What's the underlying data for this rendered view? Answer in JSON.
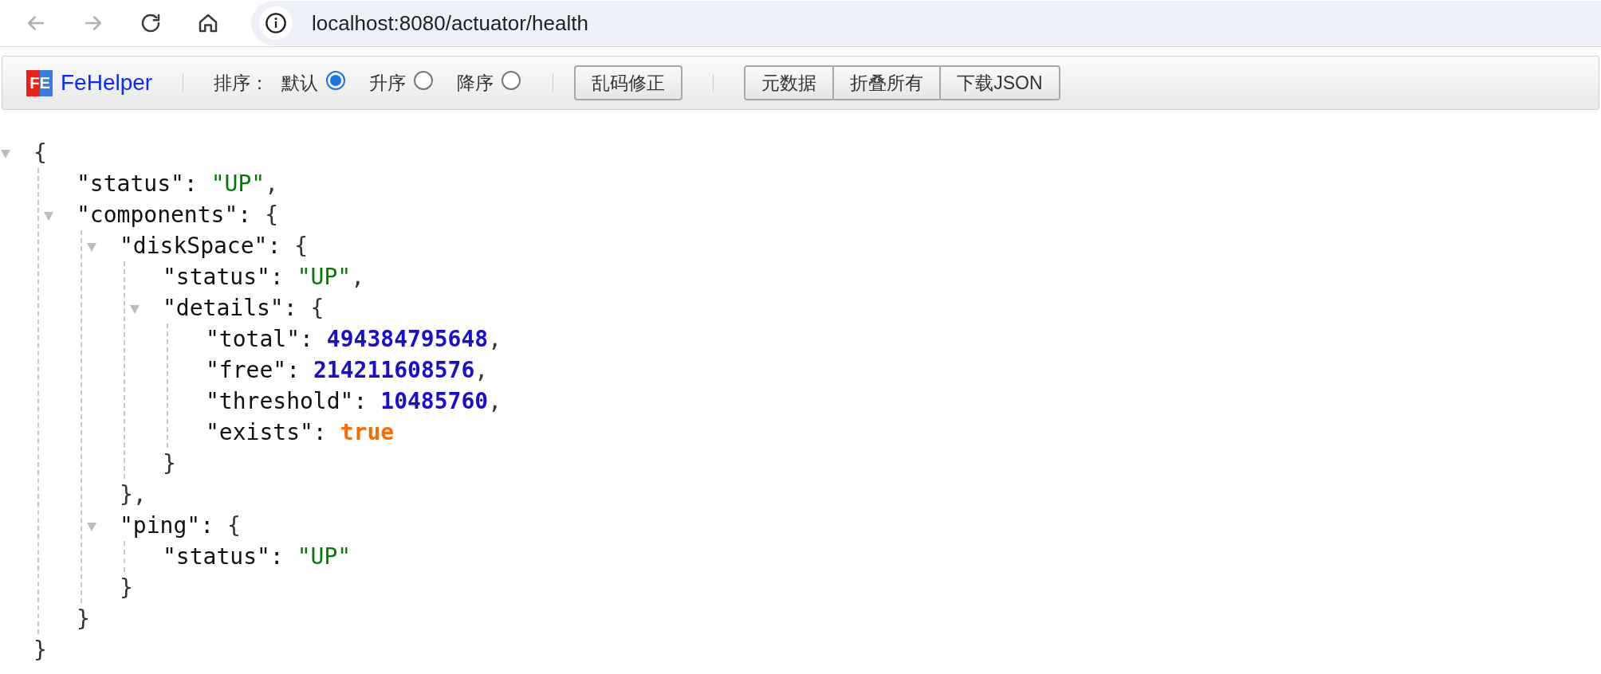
{
  "browser": {
    "nav": [
      {
        "kind": "back",
        "disabled": true
      },
      {
        "kind": "forward",
        "disabled": true
      },
      {
        "kind": "reload",
        "disabled": false
      },
      {
        "kind": "home",
        "disabled": false
      }
    ],
    "url": "localhost:8080/actuator/health"
  },
  "toolbar": {
    "logo_text": "FE",
    "brand": "FeHelper",
    "sort_label": "排序：",
    "sort_options": [
      {
        "label": "默认",
        "selected": true
      },
      {
        "label": "升序",
        "selected": false
      },
      {
        "label": "降序",
        "selected": false
      }
    ],
    "fix_button": "乱码修正",
    "button_group": [
      "元数据",
      "折叠所有",
      "下载JSON"
    ]
  },
  "json": {
    "open": "{",
    "close": "}",
    "expanded": true,
    "children": [
      {
        "kind": "string",
        "key": "\"status\":",
        "value": "\"UP\"",
        "comma": ","
      },
      {
        "kind": "object",
        "key": "\"components\":",
        "open": "{",
        "close": "}",
        "expanded": true,
        "children": [
          {
            "kind": "object",
            "key": "\"diskSpace\":",
            "open": "{",
            "close": "},",
            "expanded": true,
            "children": [
              {
                "kind": "string",
                "key": "\"status\":",
                "value": "\"UP\"",
                "comma": ","
              },
              {
                "kind": "object",
                "key": "\"details\":",
                "open": "{",
                "close": "}",
                "expanded": true,
                "children": [
                  {
                    "kind": "number",
                    "key": "\"total\":",
                    "value": "494384795648",
                    "comma": ","
                  },
                  {
                    "kind": "number",
                    "key": "\"free\":",
                    "value": "214211608576",
                    "comma": ","
                  },
                  {
                    "kind": "number",
                    "key": "\"threshold\":",
                    "value": "10485760",
                    "comma": ","
                  },
                  {
                    "kind": "boolean",
                    "key": "\"exists\":",
                    "value": "true"
                  }
                ]
              }
            ]
          },
          {
            "kind": "object",
            "key": "\"ping\":",
            "open": "{",
            "close": "}",
            "expanded": true,
            "children": [
              {
                "kind": "string",
                "key": "\"status\":",
                "value": "\"UP\""
              }
            ]
          }
        ]
      }
    ]
  }
}
